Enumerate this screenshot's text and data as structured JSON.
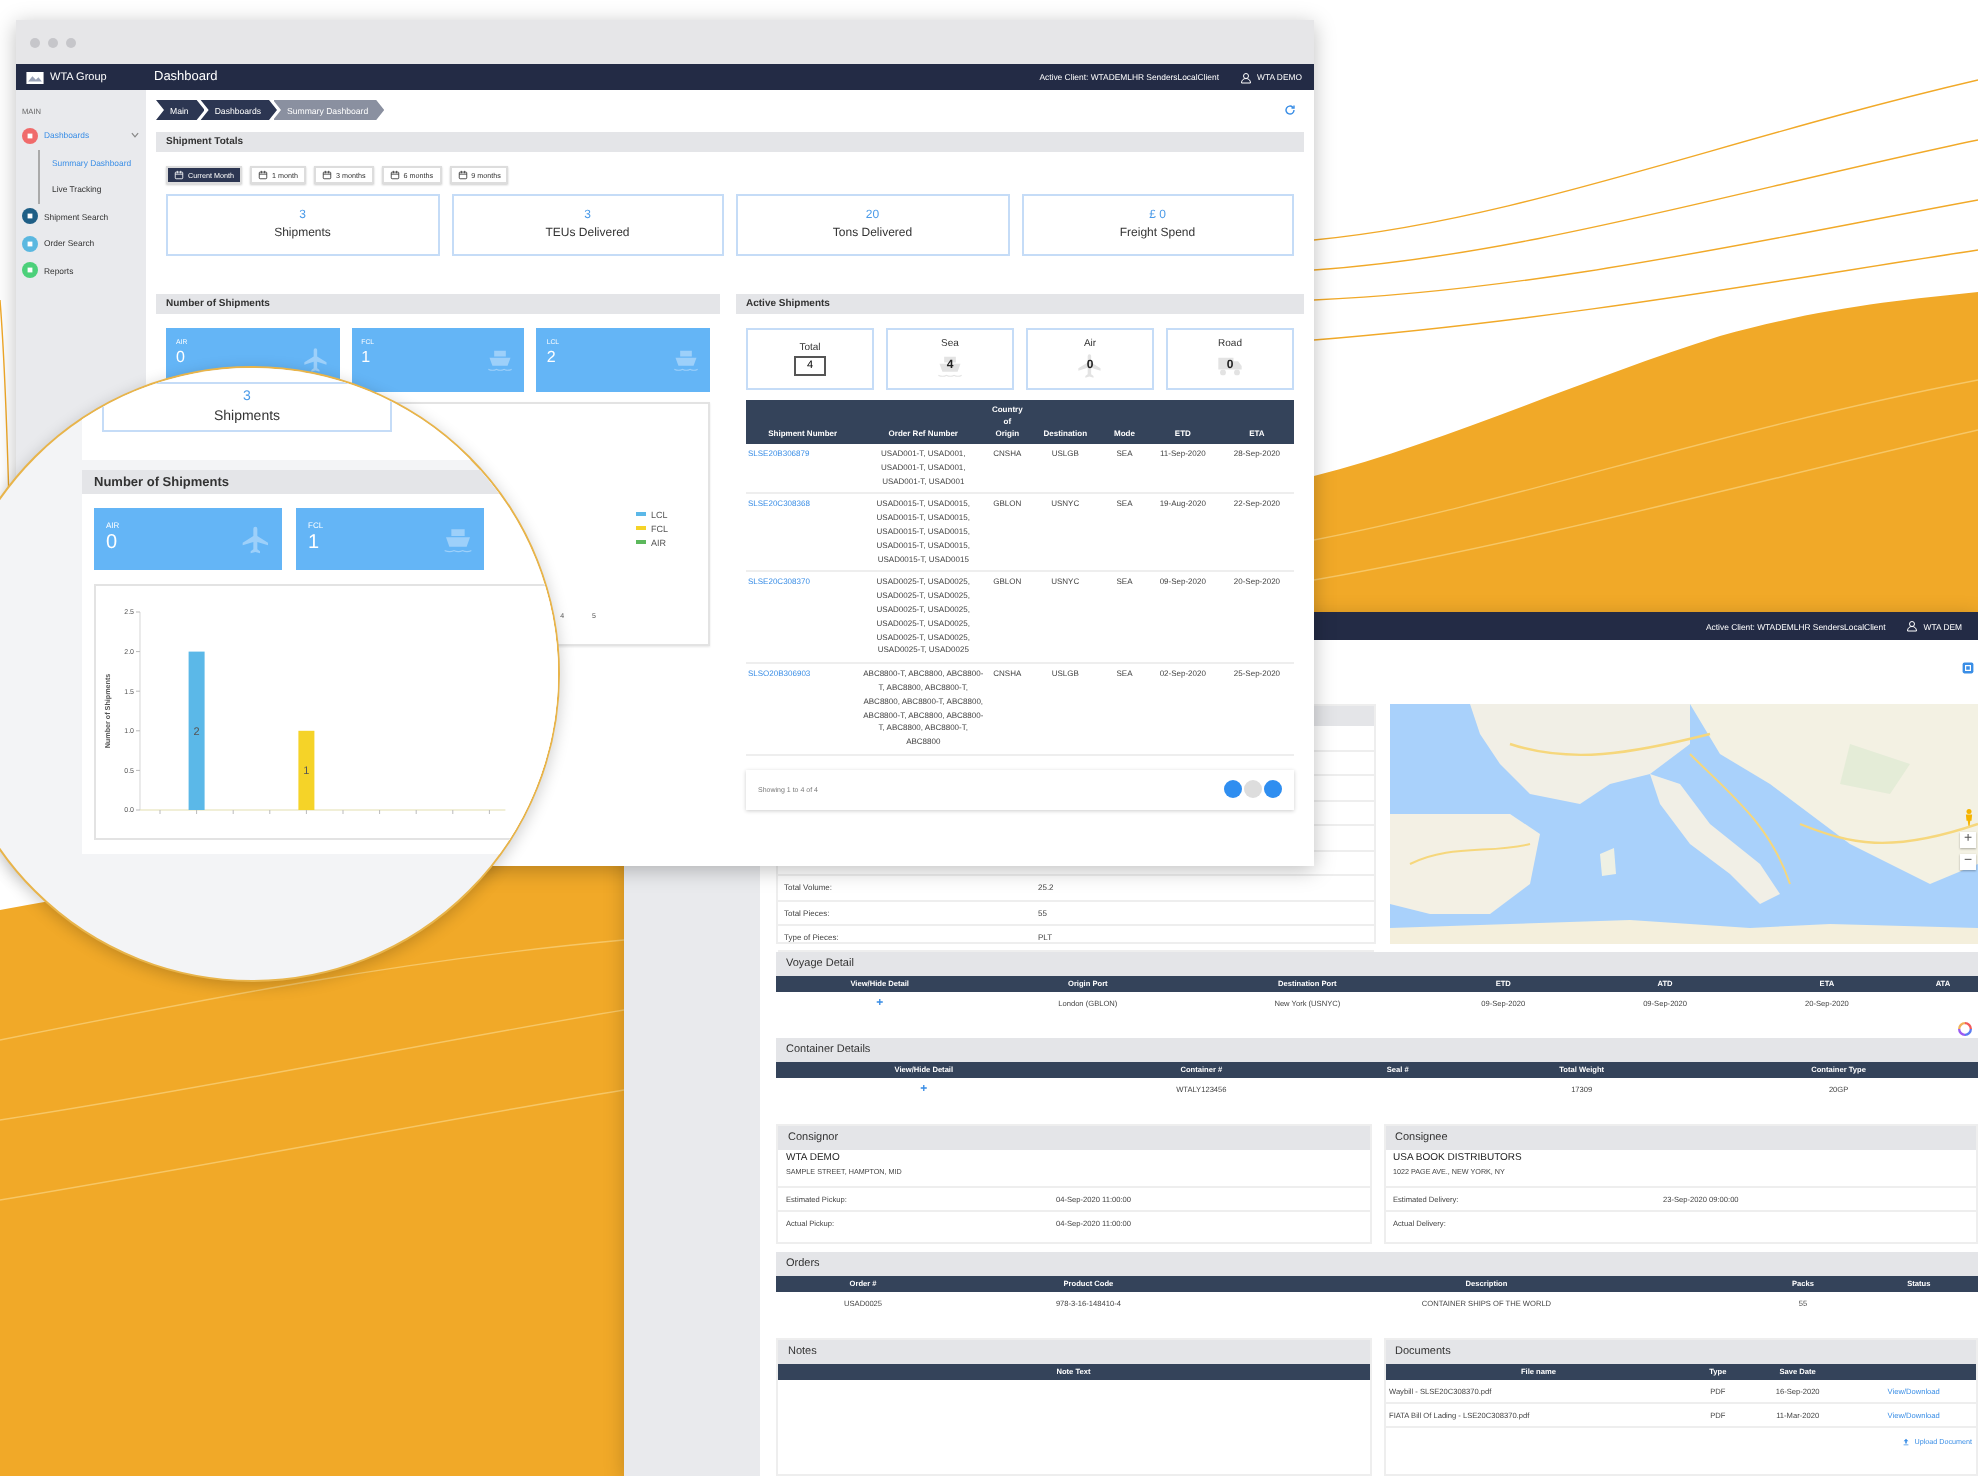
{
  "main_window": {
    "app_name": "WTA Group",
    "page_title": "Dashboard",
    "active_client": "Active Client: WTADEMLHR SendersLocalClient",
    "user": "WTA DEMO",
    "sidebar": {
      "heading": "MAIN",
      "items": [
        {
          "label": "Dashboards",
          "color": "#f06b6b",
          "children": [
            {
              "label": "Summary Dashboard",
              "selected": true
            },
            {
              "label": "Live Tracking",
              "selected": false
            }
          ]
        },
        {
          "label": "Shipment Search",
          "color": "#1f5f86"
        },
        {
          "label": "Order Search",
          "color": "#5bb8e0"
        },
        {
          "label": "Reports",
          "color": "#4cd07a"
        }
      ]
    },
    "breadcrumb": [
      {
        "label": "Main",
        "selected": false
      },
      {
        "label": "Dashboards",
        "selected": false
      },
      {
        "label": "Summary Dashboard",
        "selected": true
      }
    ],
    "shipment_totals": {
      "title": "Shipment Totals",
      "periods": [
        {
          "label": "Current Month",
          "selected": true
        },
        {
          "label": "1 month",
          "selected": false
        },
        {
          "label": "3 months",
          "selected": false
        },
        {
          "label": "6 months",
          "selected": false
        },
        {
          "label": "9 months",
          "selected": false
        }
      ],
      "stats": [
        {
          "value": "3",
          "label": "Shipments"
        },
        {
          "value": "3",
          "label": "TEUs Delivered"
        },
        {
          "value": "20",
          "label": "Tons Delivered"
        },
        {
          "value": "£ 0",
          "label": "Freight Spend"
        }
      ]
    },
    "number_of_shipments": {
      "title": "Number of Shipments",
      "tiles": [
        {
          "label": "AIR",
          "value": "0",
          "kind": "air"
        },
        {
          "label": "FCL",
          "value": "1",
          "kind": "sea"
        },
        {
          "label": "LCL",
          "value": "2",
          "kind": "sea"
        }
      ],
      "legend": [
        {
          "label": "LCL",
          "color": "#5bb8e8"
        },
        {
          "label": "FCL",
          "color": "#f5d328"
        },
        {
          "label": "AIR",
          "color": "#5cb85c"
        }
      ],
      "axis_ticks": [
        "4",
        "5"
      ]
    },
    "active_shipments": {
      "title": "Active Shipments",
      "modes": [
        {
          "label": "Total",
          "value": "4",
          "kind": "total"
        },
        {
          "label": "Sea",
          "value": "4",
          "kind": "sea"
        },
        {
          "label": "Air",
          "value": "0",
          "kind": "air"
        },
        {
          "label": "Road",
          "value": "0",
          "kind": "road"
        }
      ],
      "table": {
        "columns": [
          {
            "label": "Shipment Number",
            "kind": "link"
          },
          {
            "label": "Order Ref Number",
            "kind": "text"
          },
          {
            "label": "Country of Origin",
            "kind": "text"
          },
          {
            "label": "Destination",
            "kind": "text"
          },
          {
            "label": "Mode",
            "kind": "text"
          },
          {
            "label": "ETD",
            "kind": "text"
          },
          {
            "label": "ETA",
            "kind": "text"
          }
        ],
        "rows": [
          [
            "SLSE20B306879",
            "USAD001-T, USAD001, USAD001-T, USAD001, USAD001-T, USAD001",
            "CNSHA",
            "USLGB",
            "SEA",
            "11-Sep-2020",
            "28-Sep-2020"
          ],
          [
            "SLSE20C308368",
            "USAD0015-T, USAD0015, USAD0015-T, USAD0015, USAD0015-T, USAD0015, USAD0015-T, USAD0015, USAD0015-T, USAD0015",
            "GBLON",
            "USNYC",
            "SEA",
            "19-Aug-2020",
            "22-Sep-2020"
          ],
          [
            "SLSE20C308370",
            "USAD0025-T, USAD0025, USAD0025-T, USAD0025, USAD0025-T, USAD0025, USAD0025-T, USAD0025, USAD0025-T, USAD0025, USAD0025-T, USAD0025",
            "GBLON",
            "USNYC",
            "SEA",
            "09-Sep-2020",
            "20-Sep-2020"
          ],
          [
            "SLSO20B306903",
            "ABC8800-T, ABC8800, ABC8800-T, ABC8800, ABC8800-T, ABC8800, ABC8800-T, ABC8800, ABC8800-T, ABC8800, ABC8800-T, ABC8800, ABC8800-T, ABC8800",
            "CNSHA",
            "USLGB",
            "SEA",
            "02-Sep-2020",
            "25-Sep-2020"
          ]
        ]
      },
      "footer": "Showing 1 to 4 of 4"
    }
  },
  "magnifier": {
    "card": {
      "value": "3",
      "label": "Shipments"
    },
    "title": "Number of Shipments",
    "tiles": [
      {
        "label": "AIR",
        "value": "0",
        "kind": "air"
      },
      {
        "label": "FCL",
        "value": "1",
        "kind": "sea"
      }
    ],
    "chart_data": {
      "type": "bar",
      "ylabel": "Number of Shipments",
      "ylim": [
        0,
        2.5
      ],
      "yticks": [
        {
          "value": 0,
          "label": "0.0"
        },
        {
          "value": 0.5,
          "label": "0.5"
        },
        {
          "value": 1,
          "label": "1.0"
        },
        {
          "value": 1.5,
          "label": "1.5"
        },
        {
          "value": 2,
          "label": "2.0"
        },
        {
          "value": 2.5,
          "label": "2.5"
        }
      ],
      "data_labels": true,
      "stacked": true,
      "series": [
        {
          "color": "#5bb8e8",
          "values": [
            null,
            2,
            null,
            null,
            null,
            null,
            null,
            null,
            null,
            null
          ]
        },
        {
          "color": "#f5d328",
          "values": [
            null,
            null,
            null,
            null,
            1,
            null,
            null,
            null,
            null,
            null
          ]
        }
      ]
    }
  },
  "detail_window": {
    "active_client": "Active Client: WTADEMLHR SendersLocalClient",
    "user": "WTA DEM",
    "summary_rows": [
      {
        "label": "Total Volume:",
        "value": "25.2"
      },
      {
        "label": "Total Pieces:",
        "value": "55"
      },
      {
        "label": "Type of Pieces:",
        "value": "PLT"
      }
    ],
    "map_controls": {
      "zoom_in": "+",
      "zoom_out": "−"
    },
    "voyage": {
      "title": "Voyage Detail",
      "columns": [
        {
          "label": "View/Hide Detail",
          "kind": "toggle"
        },
        {
          "label": "Origin Port",
          "kind": "text"
        },
        {
          "label": "Destination Port",
          "kind": "text"
        },
        {
          "label": "ETD",
          "kind": "text"
        },
        {
          "label": "ATD",
          "kind": "text"
        },
        {
          "label": "ETA",
          "kind": "text"
        },
        {
          "label": "ATA",
          "kind": "text"
        }
      ],
      "rows": [
        [
          "+",
          "London (GBLON)",
          "New York (USNYC)",
          "09-Sep-2020",
          "09-Sep-2020",
          "20-Sep-2020"
        ]
      ]
    },
    "containers": {
      "title": "Container Details",
      "columns": [
        {
          "label": "View/Hide Detail",
          "kind": "toggle"
        },
        {
          "label": "Container #",
          "kind": "text"
        },
        {
          "label": "Seal #",
          "kind": "text"
        },
        {
          "label": "Total Weight",
          "kind": "text"
        },
        {
          "label": "Container Type",
          "kind": "text"
        }
      ],
      "rows": [
        [
          "+",
          "WTALY123456",
          null,
          "17309",
          "20GP"
        ]
      ]
    },
    "consignor": {
      "title": "Consignor",
      "name": "WTA DEMO",
      "address": "SAMPLE STREET, HAMPTON, MID",
      "rows": [
        {
          "label": "Estimated Pickup:",
          "value": "04-Sep-2020 11:00:00"
        },
        {
          "label": "Actual Pickup:",
          "value": "04-Sep-2020 11:00:00"
        }
      ]
    },
    "consignee": {
      "title": "Consignee",
      "name": "USA BOOK DISTRIBUTORS",
      "address": "1022 PAGE AVE., NEW YORK, NY",
      "rows": [
        {
          "label": "Estimated Delivery:",
          "value": "23-Sep-2020 09:00:00"
        },
        {
          "label": "Actual Delivery:"
        }
      ]
    },
    "orders": {
      "title": "Orders",
      "columns": [
        {
          "label": "Order #"
        },
        {
          "label": "Product Code"
        },
        {
          "label": "Description"
        },
        {
          "label": "Packs"
        },
        {
          "label": "Status"
        }
      ],
      "rows": [
        [
          "USAD0025",
          "978-3-16-148410-4",
          "CONTAINER SHIPS OF THE WORLD",
          "55"
        ]
      ]
    },
    "notes": {
      "title": "Notes",
      "columns": [
        {
          "label": "Note Text"
        }
      ]
    },
    "documents": {
      "title": "Documents",
      "columns": [
        {
          "label": "File name",
          "kind": "text"
        },
        {
          "label": "Type",
          "kind": "text"
        },
        {
          "label": "Save Date",
          "kind": "text"
        },
        {
          "kind": "link"
        }
      ],
      "rows": [
        [
          "Waybill - SLSE20C308370.pdf",
          "PDF",
          "16-Sep-2020",
          "View/Download"
        ],
        [
          "FIATA Bill Of Lading - LSE20C308370.pdf",
          "PDF",
          "11-Mar-2020",
          "View/Download"
        ]
      ],
      "upload": "Upload Document"
    }
  }
}
